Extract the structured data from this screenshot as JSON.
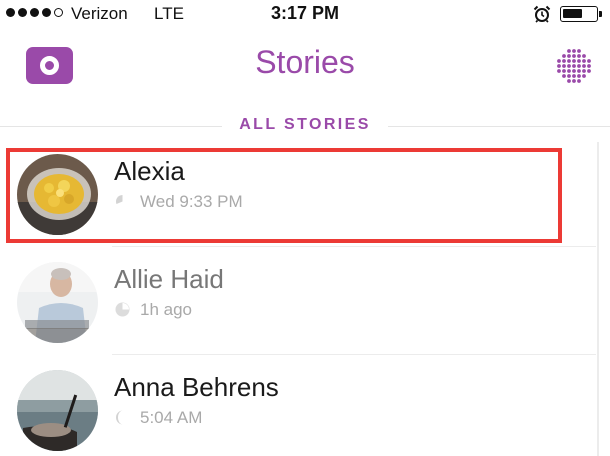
{
  "status_bar": {
    "carrier": "Verizon",
    "network": "LTE",
    "time": "3:17 PM",
    "signal_bars_filled": 4,
    "signal_bars_total": 5,
    "battery_level": 0.6
  },
  "header": {
    "title": "Stories",
    "camera_icon": "camera-icon",
    "discover_icon": "discover-dots-icon",
    "accent_color": "#9a4aa9"
  },
  "section": {
    "title": "ALL STORIES"
  },
  "stories": [
    {
      "name": "Alexia",
      "time": "Wed 9:33 PM",
      "viewed": false,
      "selected": true
    },
    {
      "name": "Allie Haid",
      "time": "1h ago",
      "viewed": true,
      "selected": false
    },
    {
      "name": "Anna Behrens",
      "time": "5:04 AM",
      "viewed": false,
      "selected": false
    }
  ],
  "selection_color": "#ec3a35"
}
